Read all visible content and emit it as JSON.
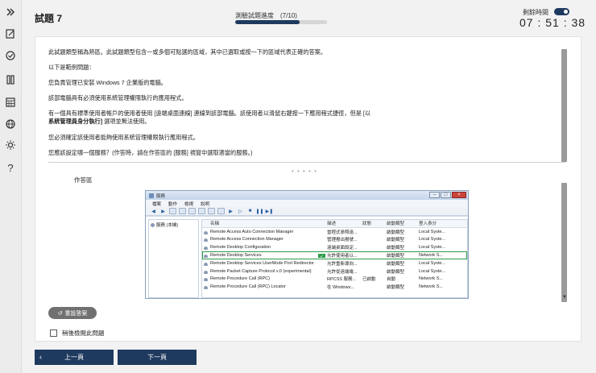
{
  "header": {
    "title": "試題 7",
    "progress_label": "測驗試題進度　(7/10)",
    "progress_fraction": 0.7,
    "timer_label": "剩餘時間",
    "timer_value": "07 : 51 : 38"
  },
  "question": {
    "intro": "此試題類型稱為熱區。此試題類型包含一或多個可點選的區域，其中已選取或按一下的區域代表正確的答案。",
    "example_label": "以下是範例問題：",
    "p1": "您負責管理已安裝 Windows 7 企業版的電腦。",
    "p2": "該部電腦具有必須使用系統管理權限執行的應用程式。",
    "p3a": "有一個具有標準使用者帳戶的使用者使用 [遠端桌面連線] 連線到該部電腦。該使用者以滑鼠右鍵按一下應用程式捷徑，但是 [以",
    "p3b": "系統管理員身分執行]",
    "p3c": " 選項並無法使用。",
    "p4": "您必須確定該使用者能夠使用系統管理權限執行應用程式。",
    "p5": "您應該設定哪一個服務？(作答時，請在作答區的 [服務] 視窗中選取適當的服務。)"
  },
  "grip": "• • • • •",
  "work_area_label": "作答區",
  "services_window": {
    "title": "服務",
    "menu": [
      "檔案",
      "動作",
      "檢視",
      "說明"
    ],
    "tree_root": "服務 (本機)",
    "columns": [
      "名稱",
      "描述",
      "狀態",
      "啟動類型",
      "登入身分"
    ],
    "rows": [
      {
        "name": "Remote Access Auto Connection Manager",
        "desc": "當程式參照遠...",
        "status": "",
        "start": "啟動類型",
        "account": "Local Syste..."
      },
      {
        "name": "Remote Access Connection Manager",
        "desc": "管理撥出撥號...",
        "status": "",
        "start": "啟動類型",
        "account": "Local Syste..."
      },
      {
        "name": "Remote Desktop Configuration",
        "desc": "遠端桌面設定...",
        "status": "",
        "start": "啟動類型",
        "account": "Local Syste..."
      },
      {
        "name": "Remote Desktop Services",
        "desc": "允許使用者以...",
        "status": "",
        "start": "啟動類型",
        "account": "Network S...",
        "selected": true
      },
      {
        "name": "Remote Desktop Services UserMode Port Redirector",
        "desc": "允許重新導向...",
        "status": "",
        "start": "啟動類型",
        "account": "Local Syste..."
      },
      {
        "name": "Remote Packet Capture Protocol v.0 (experimental)",
        "desc": "允許從遠端電...",
        "status": "",
        "start": "啟動類型",
        "account": "Local Syste..."
      },
      {
        "name": "Remote Procedure Call (RPC)",
        "desc": "RPCSS 服務...",
        "status": "已啟動",
        "start": "自動",
        "account": "Network S..."
      },
      {
        "name": "Remote Procedure Call (RPC) Locator",
        "desc": "在 Windows...",
        "status": "",
        "start": "啟動類型",
        "account": "Network S..."
      },
      {
        "name": "",
        "desc": "",
        "status": "",
        "start": "",
        "account": ""
      }
    ]
  },
  "reset_label": "重設答案",
  "review_label": "稍後檢閱此問題",
  "nav": {
    "prev": "上一頁",
    "next": "下一頁"
  },
  "colors": {
    "primary": "#1f3a5f",
    "select_green": "#2e9a4a"
  }
}
